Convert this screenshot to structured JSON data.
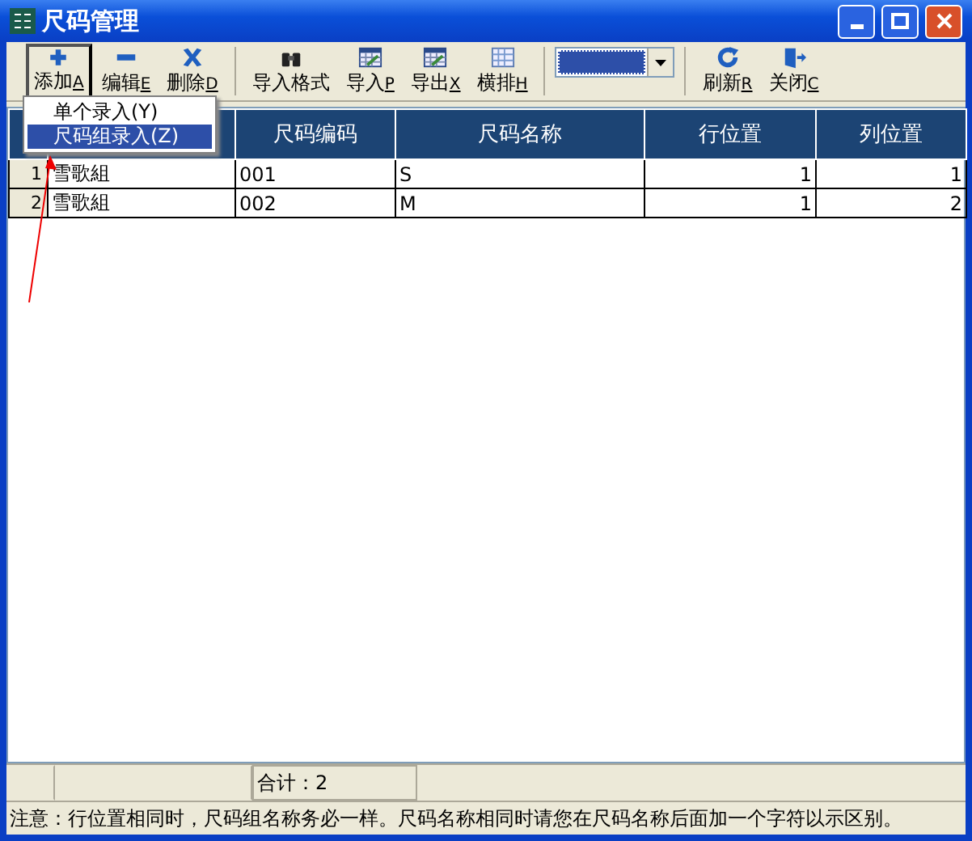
{
  "window": {
    "title": "尺码管理"
  },
  "toolbar": [
    {
      "kind": "plus",
      "label": "添加",
      "key": "A",
      "pressed": true
    },
    {
      "kind": "minus",
      "label": "编辑",
      "key": "E",
      "pressed": false
    },
    {
      "kind": "cross",
      "label": "删除",
      "key": "D",
      "pressed": false
    },
    {
      "kind": "binoculars",
      "label": "导入格式",
      "pressed": false
    },
    {
      "kind": "sheet",
      "label": "导入",
      "key": "P",
      "pressed": false
    },
    {
      "kind": "sheet",
      "label": "导出",
      "key": "X",
      "pressed": false
    },
    {
      "kind": "grid",
      "label": "横排",
      "key": "H",
      "pressed": false
    },
    {
      "kind": "combo"
    },
    {
      "kind": "refresh",
      "label": "刷新",
      "key": "R",
      "pressed": false
    },
    {
      "kind": "door",
      "label": "关闭",
      "key": "C",
      "pressed": false
    }
  ],
  "menu": [
    {
      "label": "单个录入(Y)",
      "selected": false
    },
    {
      "label": "尺码组录入(Z)",
      "selected": true
    }
  ],
  "table": {
    "columns": [
      {},
      {},
      {
        "label": "尺码编码"
      },
      {
        "label": "尺码名称"
      },
      {
        "label": "行位置"
      },
      {
        "label": "列位置"
      }
    ],
    "rows": [
      [
        "1",
        "雪歌組",
        "001",
        "S",
        "1",
        "1"
      ],
      [
        "2",
        "雪歌組",
        "002",
        "M",
        "1",
        "2"
      ]
    ]
  },
  "summary": "合计：2",
  "status_bar": "注意：行位置相同时，尺码组名称务必一样。尺码名称相同时请您在尺码名称后面加一个字符以示区别。"
}
